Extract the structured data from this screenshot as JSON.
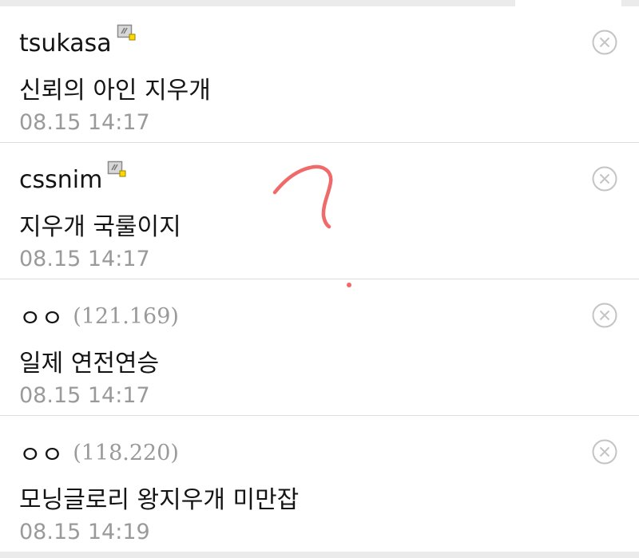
{
  "comments": [
    {
      "nickname": "tsukasa",
      "ip": "",
      "has_badge": true,
      "text": "신뢰의 아인 지우개",
      "time": "08.15 14:17"
    },
    {
      "nickname": "cssnim",
      "ip": "",
      "has_badge": true,
      "text": "지우개 국룰이지",
      "time": "08.15 14:17"
    },
    {
      "nickname": "ㅇㅇ",
      "ip": "(121.169)",
      "has_badge": false,
      "text": "일제 연전연승",
      "time": "08.15 14:17"
    },
    {
      "nickname": "ㅇㅇ",
      "ip": "(118.220)",
      "has_badge": false,
      "text": "모닝글로리 왕지우개 미만잡",
      "time": "08.15 14:19"
    }
  ],
  "icons": {
    "delete": "close-circle-icon",
    "badge": "fixed-nick-badge-icon"
  },
  "colors": {
    "text": "#141414",
    "muted": "#9a9a9a",
    "divider": "#dcdce2",
    "delete_icon": "#c4c4c4",
    "scribble": "#f06a6a"
  }
}
